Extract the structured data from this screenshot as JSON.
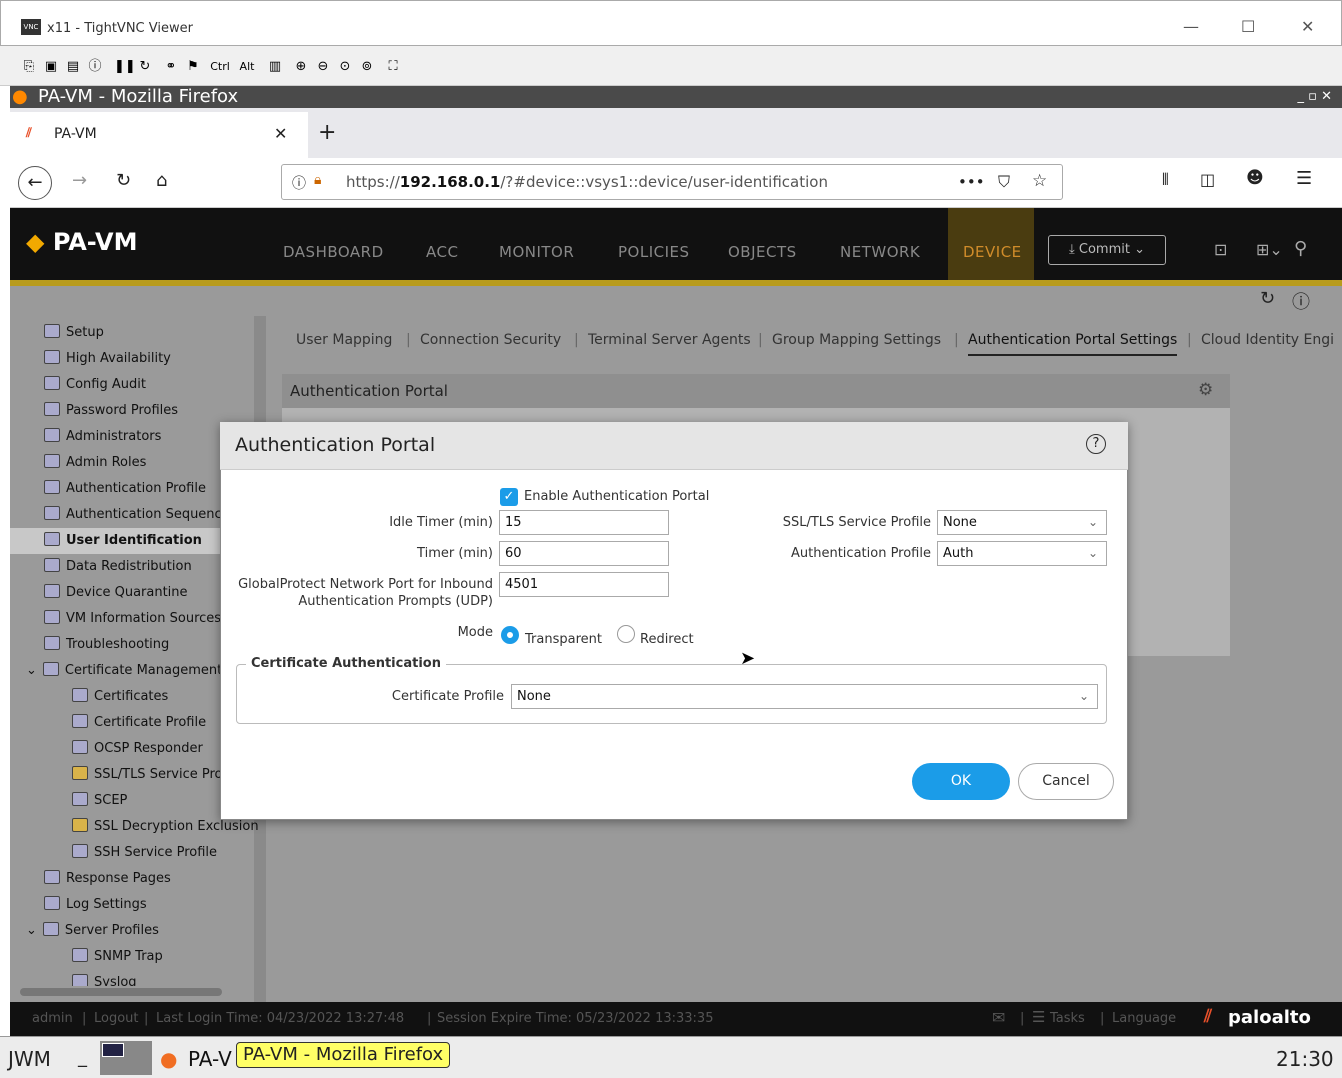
{
  "vnc": {
    "title": "x11 - TightVNC Viewer",
    "toolbar": [
      "Ctrl",
      "Alt"
    ]
  },
  "firefox": {
    "window_title": "PA-VM - Mozilla Firefox",
    "tab_label": "PA-VM",
    "url_prefix": "https://",
    "url_host": "192.168.0.1",
    "url_path": "/?#device::vsys1::device/user-identification"
  },
  "app": {
    "logo": "PA-VM",
    "nav": [
      "DASHBOARD",
      "ACC",
      "MONITOR",
      "POLICIES",
      "OBJECTS",
      "NETWORK",
      "DEVICE"
    ],
    "active_nav": "DEVICE",
    "commit_label": "Commit"
  },
  "sidebar": {
    "items": [
      {
        "label": "Setup"
      },
      {
        "label": "High Availability"
      },
      {
        "label": "Config Audit"
      },
      {
        "label": "Password Profiles"
      },
      {
        "label": "Administrators"
      },
      {
        "label": "Admin Roles"
      },
      {
        "label": "Authentication Profile"
      },
      {
        "label": "Authentication Sequence"
      },
      {
        "label": "User Identification"
      },
      {
        "label": "Data Redistribution"
      },
      {
        "label": "Device Quarantine"
      },
      {
        "label": "VM Information Sources"
      },
      {
        "label": "Troubleshooting"
      },
      {
        "label": "Certificate Management"
      },
      {
        "label": "Certificates"
      },
      {
        "label": "Certificate Profile"
      },
      {
        "label": "OCSP Responder"
      },
      {
        "label": "SSL/TLS Service Profile"
      },
      {
        "label": "SCEP"
      },
      {
        "label": "SSL Decryption Exclusion"
      },
      {
        "label": "SSH Service Profile"
      },
      {
        "label": "Response Pages"
      },
      {
        "label": "Log Settings"
      },
      {
        "label": "Server Profiles"
      },
      {
        "label": "SNMP Trap"
      },
      {
        "label": "Syslog"
      }
    ],
    "active": "User Identification"
  },
  "content_tabs": [
    "User Mapping",
    "Connection Security",
    "Terminal Server Agents",
    "Group Mapping Settings",
    "Authentication Portal Settings",
    "Cloud Identity Engi"
  ],
  "active_tab": "Authentication Portal Settings",
  "panel_title": "Authentication Portal",
  "modal": {
    "title": "Authentication Portal",
    "enable_label": "Enable Authentication Portal",
    "enable_checked": true,
    "idle_timer_label": "Idle Timer (min)",
    "idle_timer_value": "15",
    "timer_label": "Timer (min)",
    "timer_value": "60",
    "gp_port_label_1": "GlobalProtect Network Port for Inbound",
    "gp_port_label_2": "Authentication Prompts (UDP)",
    "gp_port_value": "4501",
    "mode_label": "Mode",
    "mode_transparent": "Transparent",
    "mode_redirect": "Redirect",
    "mode_selected": "Transparent",
    "ssl_label": "SSL/TLS Service Profile",
    "ssl_value": "None",
    "auth_profile_label": "Authentication Profile",
    "auth_profile_value": "Auth",
    "cert_section": "Certificate Authentication",
    "cert_profile_label": "Certificate Profile",
    "cert_profile_value": "None",
    "ok_label": "OK",
    "cancel_label": "Cancel"
  },
  "status": {
    "user": "admin",
    "logout": "Logout",
    "last_login": "Last Login Time: 04/23/2022 13:27:48",
    "session_expire": "Session Expire Time: 05/23/2022 13:33:35",
    "tasks": "Tasks",
    "language": "Language",
    "brand": "paloalto"
  },
  "taskbar": {
    "wm": "JWM",
    "app_short": "PA-V",
    "tooltip": "PA-VM - Mozilla Firefox",
    "clock": "21:30"
  }
}
